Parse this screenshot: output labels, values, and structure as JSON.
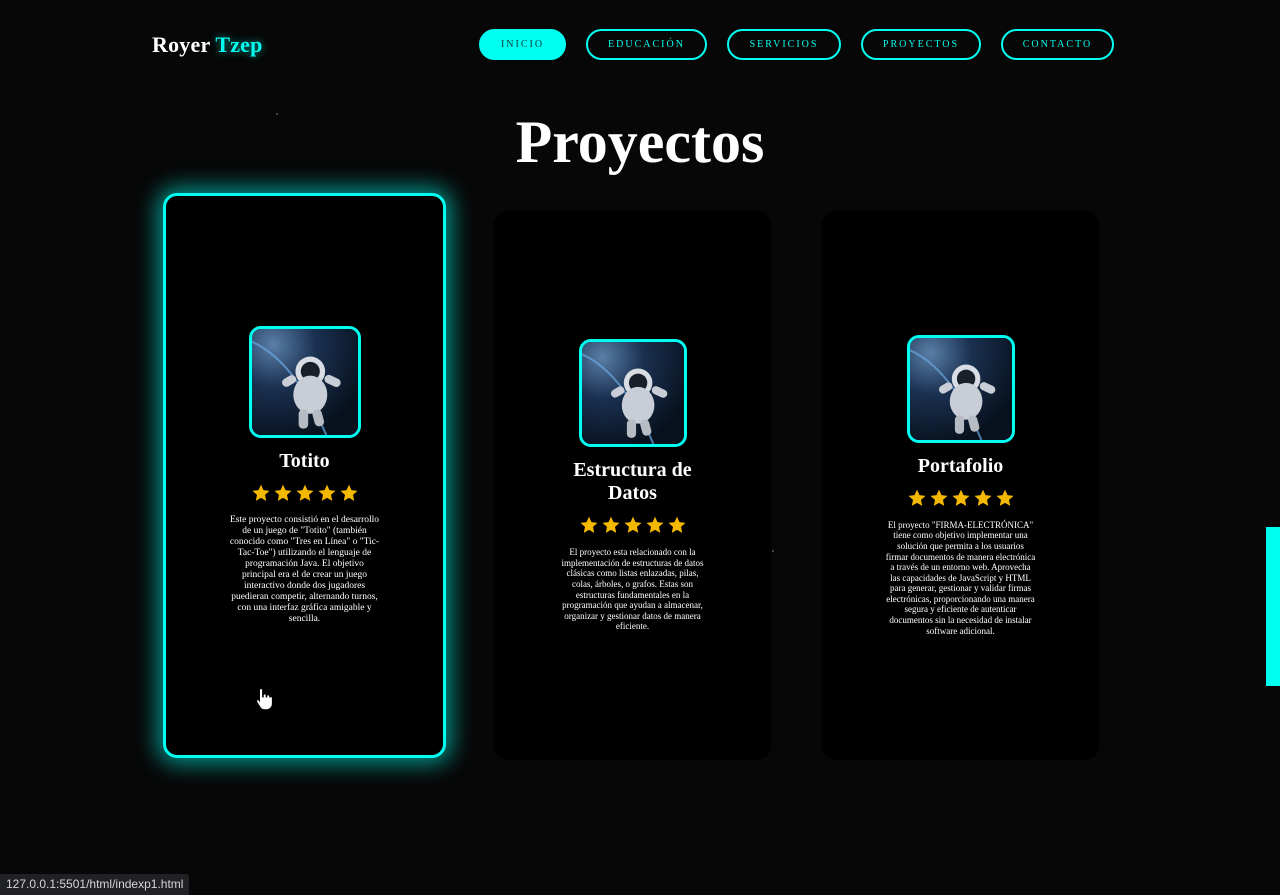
{
  "header": {
    "logo_first": "Royer",
    "logo_second": "Tzep",
    "nav": [
      {
        "label": "INICIO",
        "active": true
      },
      {
        "label": "EDUCACIÓN",
        "active": false
      },
      {
        "label": "SERVICIOS",
        "active": false
      },
      {
        "label": "PROYECTOS",
        "active": false
      },
      {
        "label": "CONTACTO",
        "active": false
      }
    ]
  },
  "main": {
    "title": "Proyectos",
    "cards": [
      {
        "title": "Totito",
        "rating": 5,
        "image_icon": "astronaut-image",
        "description": "Este proyecto consistió en el desarrollo de un juego de \"Totito\" (también conocido como \"Tres en Línea\" o \"Tic-Tac-Toe\") utilizando el lenguaje de programación Java. El objetivo principal era el de crear un juego interactivo donde dos jugadores puedieran competir, alternando turnos, con una interfaz gráfica amigable y sencilla."
      },
      {
        "title": "Estructura de Datos",
        "rating": 5,
        "image_icon": "astronaut-image",
        "description": "El proyecto esta relacionado con la implementación de estructuras de datos clásicas como listas enlazadas, pilas, colas, árboles, o grafos. Estas son estructuras fundamentales en la programación que ayudan a almacenar, organizar y gestionar datos de manera eficiente."
      },
      {
        "title": "Portafolio",
        "rating": 5,
        "image_icon": "astronaut-image",
        "description": "El proyecto \"FIRMA-ELECTRÓNICA\" tiene como objetivo implementar una solución que permita a los usuarios firmar documentos de manera electrónica a través de un entorno web. Aprovecha las capacidades de JavaScript y HTML para generar, gestionar y validar firmas electrónicas, proporcionando una manera segura y eficiente de autenticar documentos sin la necesidad de instalar software adicional."
      }
    ]
  },
  "status_bar": {
    "url": "127.0.0.1:5501/html/indexp1.html"
  },
  "colors": {
    "accent": "#00fff0",
    "background": "#070707",
    "star": "#f5b800"
  }
}
